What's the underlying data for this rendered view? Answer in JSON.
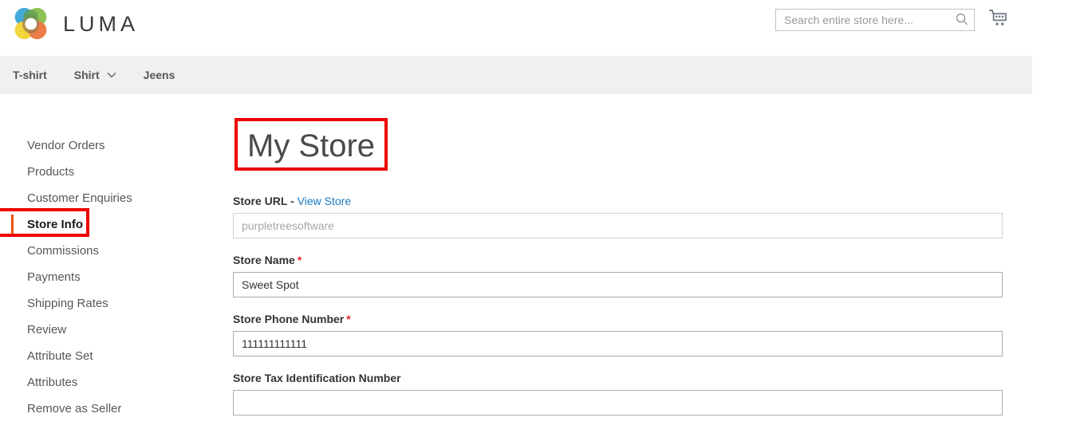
{
  "header": {
    "brand": "LUMA",
    "logo_icon": "luma-flower-logo",
    "logo_colors": [
      "#2a9fd6",
      "#7eba3d",
      "#e8a33d",
      "#f2d024",
      "#e8642c",
      "#8c6239",
      "#4c8c2b"
    ],
    "search": {
      "placeholder": "Search entire store here...",
      "value": "",
      "icon": "search-icon"
    },
    "cart": {
      "icon": "shopping-cart-icon",
      "label": "My Cart"
    }
  },
  "nav": {
    "items": [
      {
        "label": "T-shirt",
        "has_dropdown": false
      },
      {
        "label": "Shirt",
        "has_dropdown": true,
        "icon": "chevron-down-icon"
      },
      {
        "label": "Jeens",
        "has_dropdown": false
      }
    ]
  },
  "sidebar": {
    "items": [
      {
        "label": "Vendor Orders",
        "active": false
      },
      {
        "label": "Products",
        "active": false
      },
      {
        "label": "Customer Enquiries",
        "active": false
      },
      {
        "label": "Store Info",
        "active": true
      },
      {
        "label": "Commissions",
        "active": false
      },
      {
        "label": "Payments",
        "active": false
      },
      {
        "label": "Shipping Rates",
        "active": false
      },
      {
        "label": "Review",
        "active": false
      },
      {
        "label": "Attribute Set",
        "active": false
      },
      {
        "label": "Attributes",
        "active": false
      },
      {
        "label": "Remove as Seller",
        "active": false
      }
    ]
  },
  "main": {
    "title": "My Store",
    "fields": [
      {
        "label": "Store URL",
        "separator": " - ",
        "link_label": "View Store",
        "required": false,
        "value": "",
        "placeholder": "purpletreesoftware",
        "muted": true
      },
      {
        "label": "Store Name",
        "required": true,
        "required_mark": "*",
        "value": "Sweet Spot",
        "placeholder": "",
        "muted": false
      },
      {
        "label": "Store Phone Number",
        "required": true,
        "required_mark": "*",
        "value": "111111111111",
        "placeholder": "",
        "muted": false
      },
      {
        "label": "Store Tax Identification Number",
        "required": false,
        "value": "",
        "placeholder": "",
        "muted": false
      }
    ]
  },
  "annotations": {
    "color": "#ee0000",
    "boxes": [
      "page-title",
      "sidebar-item-store-info"
    ]
  }
}
